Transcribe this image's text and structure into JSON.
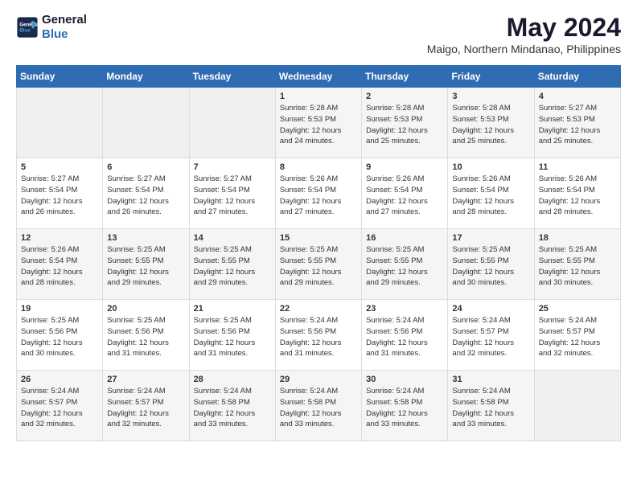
{
  "logo": {
    "line1": "General",
    "line2": "Blue"
  },
  "title": "May 2024",
  "location": "Maigo, Northern Mindanao, Philippines",
  "days_header": [
    "Sunday",
    "Monday",
    "Tuesday",
    "Wednesday",
    "Thursday",
    "Friday",
    "Saturday"
  ],
  "weeks": [
    [
      {
        "day": "",
        "info": ""
      },
      {
        "day": "",
        "info": ""
      },
      {
        "day": "",
        "info": ""
      },
      {
        "day": "1",
        "info": "Sunrise: 5:28 AM\nSunset: 5:53 PM\nDaylight: 12 hours\nand 24 minutes."
      },
      {
        "day": "2",
        "info": "Sunrise: 5:28 AM\nSunset: 5:53 PM\nDaylight: 12 hours\nand 25 minutes."
      },
      {
        "day": "3",
        "info": "Sunrise: 5:28 AM\nSunset: 5:53 PM\nDaylight: 12 hours\nand 25 minutes."
      },
      {
        "day": "4",
        "info": "Sunrise: 5:27 AM\nSunset: 5:53 PM\nDaylight: 12 hours\nand 25 minutes."
      }
    ],
    [
      {
        "day": "5",
        "info": "Sunrise: 5:27 AM\nSunset: 5:54 PM\nDaylight: 12 hours\nand 26 minutes."
      },
      {
        "day": "6",
        "info": "Sunrise: 5:27 AM\nSunset: 5:54 PM\nDaylight: 12 hours\nand 26 minutes."
      },
      {
        "day": "7",
        "info": "Sunrise: 5:27 AM\nSunset: 5:54 PM\nDaylight: 12 hours\nand 27 minutes."
      },
      {
        "day": "8",
        "info": "Sunrise: 5:26 AM\nSunset: 5:54 PM\nDaylight: 12 hours\nand 27 minutes."
      },
      {
        "day": "9",
        "info": "Sunrise: 5:26 AM\nSunset: 5:54 PM\nDaylight: 12 hours\nand 27 minutes."
      },
      {
        "day": "10",
        "info": "Sunrise: 5:26 AM\nSunset: 5:54 PM\nDaylight: 12 hours\nand 28 minutes."
      },
      {
        "day": "11",
        "info": "Sunrise: 5:26 AM\nSunset: 5:54 PM\nDaylight: 12 hours\nand 28 minutes."
      }
    ],
    [
      {
        "day": "12",
        "info": "Sunrise: 5:26 AM\nSunset: 5:54 PM\nDaylight: 12 hours\nand 28 minutes."
      },
      {
        "day": "13",
        "info": "Sunrise: 5:25 AM\nSunset: 5:55 PM\nDaylight: 12 hours\nand 29 minutes."
      },
      {
        "day": "14",
        "info": "Sunrise: 5:25 AM\nSunset: 5:55 PM\nDaylight: 12 hours\nand 29 minutes."
      },
      {
        "day": "15",
        "info": "Sunrise: 5:25 AM\nSunset: 5:55 PM\nDaylight: 12 hours\nand 29 minutes."
      },
      {
        "day": "16",
        "info": "Sunrise: 5:25 AM\nSunset: 5:55 PM\nDaylight: 12 hours\nand 29 minutes."
      },
      {
        "day": "17",
        "info": "Sunrise: 5:25 AM\nSunset: 5:55 PM\nDaylight: 12 hours\nand 30 minutes."
      },
      {
        "day": "18",
        "info": "Sunrise: 5:25 AM\nSunset: 5:55 PM\nDaylight: 12 hours\nand 30 minutes."
      }
    ],
    [
      {
        "day": "19",
        "info": "Sunrise: 5:25 AM\nSunset: 5:56 PM\nDaylight: 12 hours\nand 30 minutes."
      },
      {
        "day": "20",
        "info": "Sunrise: 5:25 AM\nSunset: 5:56 PM\nDaylight: 12 hours\nand 31 minutes."
      },
      {
        "day": "21",
        "info": "Sunrise: 5:25 AM\nSunset: 5:56 PM\nDaylight: 12 hours\nand 31 minutes."
      },
      {
        "day": "22",
        "info": "Sunrise: 5:24 AM\nSunset: 5:56 PM\nDaylight: 12 hours\nand 31 minutes."
      },
      {
        "day": "23",
        "info": "Sunrise: 5:24 AM\nSunset: 5:56 PM\nDaylight: 12 hours\nand 31 minutes."
      },
      {
        "day": "24",
        "info": "Sunrise: 5:24 AM\nSunset: 5:57 PM\nDaylight: 12 hours\nand 32 minutes."
      },
      {
        "day": "25",
        "info": "Sunrise: 5:24 AM\nSunset: 5:57 PM\nDaylight: 12 hours\nand 32 minutes."
      }
    ],
    [
      {
        "day": "26",
        "info": "Sunrise: 5:24 AM\nSunset: 5:57 PM\nDaylight: 12 hours\nand 32 minutes."
      },
      {
        "day": "27",
        "info": "Sunrise: 5:24 AM\nSunset: 5:57 PM\nDaylight: 12 hours\nand 32 minutes."
      },
      {
        "day": "28",
        "info": "Sunrise: 5:24 AM\nSunset: 5:58 PM\nDaylight: 12 hours\nand 33 minutes."
      },
      {
        "day": "29",
        "info": "Sunrise: 5:24 AM\nSunset: 5:58 PM\nDaylight: 12 hours\nand 33 minutes."
      },
      {
        "day": "30",
        "info": "Sunrise: 5:24 AM\nSunset: 5:58 PM\nDaylight: 12 hours\nand 33 minutes."
      },
      {
        "day": "31",
        "info": "Sunrise: 5:24 AM\nSunset: 5:58 PM\nDaylight: 12 hours\nand 33 minutes."
      },
      {
        "day": "",
        "info": ""
      }
    ]
  ]
}
